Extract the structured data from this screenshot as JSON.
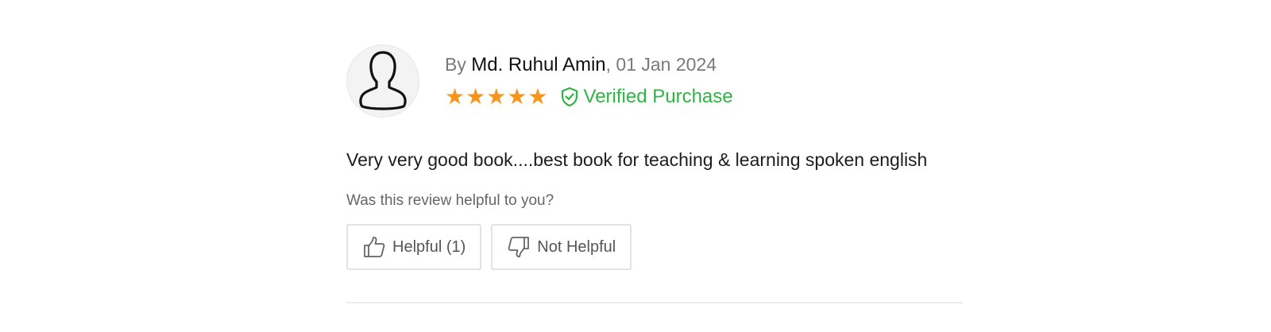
{
  "review": {
    "by_prefix": "By ",
    "author": "Md. Ruhul Amin",
    "date_separator": ", ",
    "date": "01 Jan 2024",
    "rating": 5,
    "rating_max": 5,
    "stars_text": "★★★★★",
    "verified_label": "Verified Purchase",
    "text": "Very very good book....best book for teaching & learning spoken english",
    "helpful_question": "Was this review helpful to you?",
    "helpful_label": "Helpful (1)",
    "not_helpful_label": "Not Helpful"
  },
  "icons": {
    "avatar": "user-silhouette-icon",
    "verified": "shield-check-icon",
    "helpful": "thumbs-up-icon",
    "not_helpful": "thumbs-down-icon"
  },
  "colors": {
    "star": "#f7941d",
    "verified": "#2fb543",
    "author": "#111111",
    "muted": "#7a7a7a"
  }
}
